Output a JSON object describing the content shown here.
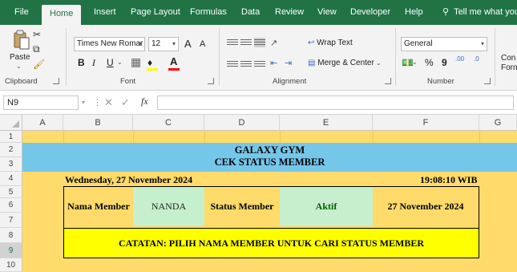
{
  "tabs": {
    "file": "File",
    "home": "Home",
    "insert": "Insert",
    "page_layout": "Page Layout",
    "formulas": "Formulas",
    "data": "Data",
    "review": "Review",
    "view": "View",
    "developer": "Developer",
    "help": "Help",
    "tell_me": "Tell me what you"
  },
  "ribbon": {
    "clipboard": {
      "paste": "Paste",
      "label": "Clipboard"
    },
    "font": {
      "font_name": "Times New Romar",
      "font_size": "12",
      "grow": "A",
      "shrink": "A",
      "bold": "B",
      "italic": "I",
      "underline": "U",
      "font_color_letter": "A",
      "label": "Font"
    },
    "alignment": {
      "wrap_text": "Wrap Text",
      "merge_center": "Merge & Center",
      "label": "Alignment"
    },
    "number": {
      "format": "General",
      "percent": "%",
      "comma": "9",
      "inc_decimal": ".00",
      "dec_decimal": ".0",
      "label": "Number"
    },
    "styles": {
      "conditional": "Con",
      "format": "Forn"
    }
  },
  "formula_bar": {
    "name_box": "N9",
    "cancel": "✕",
    "enter": "✓",
    "fx": "fx",
    "content": ""
  },
  "columns": [
    "A",
    "B",
    "C",
    "D",
    "E",
    "F",
    "G"
  ],
  "rows": [
    "1",
    "2",
    "3",
    "4",
    "5",
    "6",
    "7",
    "8",
    "9",
    "10"
  ],
  "sheet": {
    "title": "GALAXY GYM",
    "subtitle": "CEK STATUS MEMBER",
    "date": "Wednesday, 27 November 2024",
    "time": "19:08:10 WIB",
    "name_label": "Nama Member",
    "name_value": "NANDA",
    "status_label": "Status Member",
    "status_value": "Aktif",
    "check_date": "27 November 2024",
    "note": "CATATAN: PILIH NAMA MEMBER UNTUK CARI STATUS MEMBER"
  },
  "colors": {
    "excel_green": "#217346",
    "sheet_yellow": "#fedb6a",
    "band_blue": "#75c7ea",
    "value_green": "#c6efce",
    "note_yellow": "#ffff00",
    "status_green_text": "#006100"
  }
}
